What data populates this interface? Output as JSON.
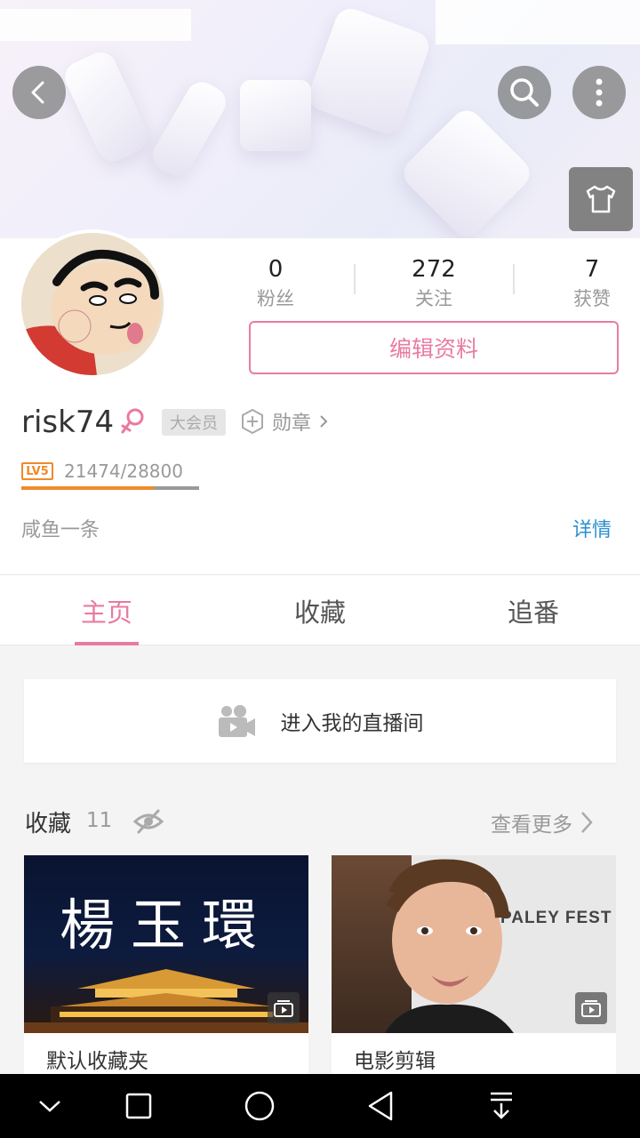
{
  "header": {
    "back_icon": "back-arrow-icon",
    "search_icon": "search-icon",
    "more_icon": "more-vertical-icon",
    "skin_icon": "tshirt-icon"
  },
  "profile": {
    "stats": [
      {
        "value": "0",
        "label": "粉丝"
      },
      {
        "value": "272",
        "label": "关注"
      },
      {
        "value": "7",
        "label": "获赞"
      }
    ],
    "edit_label": "编辑资料",
    "username": "risk74",
    "gender_icon": "female-icon",
    "vip_label": "大会员",
    "medal_label": "勋章",
    "level_label": "LV5",
    "exp_text": "21474/28800",
    "exp_progress": 0.746,
    "signature": "咸鱼一条",
    "detail_label": "详情"
  },
  "tabs": [
    {
      "label": "主页",
      "active": true
    },
    {
      "label": "收藏",
      "active": false
    },
    {
      "label": "追番",
      "active": false
    }
  ],
  "live": {
    "label": "进入我的直播间",
    "icon": "video-camera-icon"
  },
  "favorites": {
    "title": "收藏",
    "count": "11",
    "visibility_icon": "eye-off-icon",
    "more_label": "查看更多",
    "items": [
      {
        "name": "默认收藏夹",
        "thumb_text": "楊玉環"
      },
      {
        "name": "电影剪辑",
        "thumb_text": "PALEY FEST"
      }
    ]
  },
  "colors": {
    "accent": "#e87ba2",
    "link": "#2a8fd0",
    "level": "#f08a2a"
  }
}
